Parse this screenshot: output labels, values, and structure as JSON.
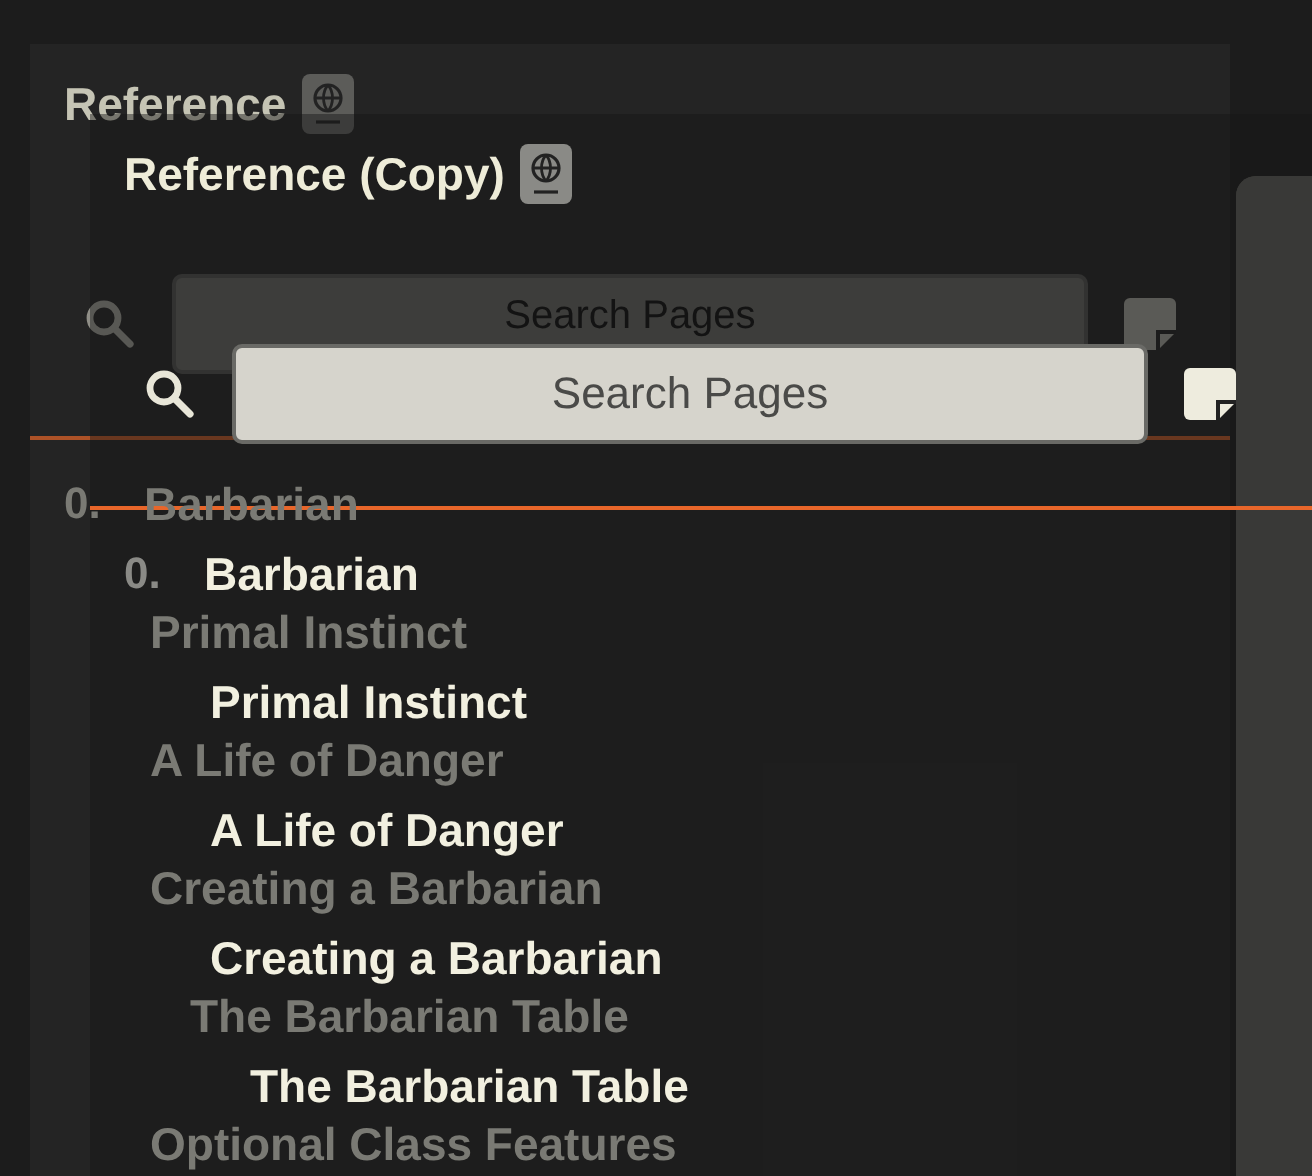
{
  "background_panel": {
    "title": "Reference",
    "dimmed": true,
    "search": {
      "placeholder": "Search Pages"
    },
    "toc": [
      {
        "number": "0.",
        "title": "Barbarian",
        "children": [
          {
            "title": "Primal Instinct"
          },
          {
            "title": "A Life of Danger"
          },
          {
            "title": "Creating a Barbarian",
            "children": [
              {
                "title": "The Barbarian Table"
              }
            ]
          },
          {
            "title": "Optional Class Features"
          }
        ]
      }
    ]
  },
  "copy_panel": {
    "title": "Reference (Copy)",
    "dimmed": false,
    "search": {
      "placeholder": "Search Pages"
    },
    "toc": [
      {
        "number": "0.",
        "title": "Barbarian",
        "children": [
          {
            "title": "Primal Instinct"
          },
          {
            "title": "A Life of Danger"
          },
          {
            "title": "Creating a Barbarian",
            "children": [
              {
                "title": "The Barbarian Table"
              }
            ]
          }
        ]
      }
    ]
  }
}
